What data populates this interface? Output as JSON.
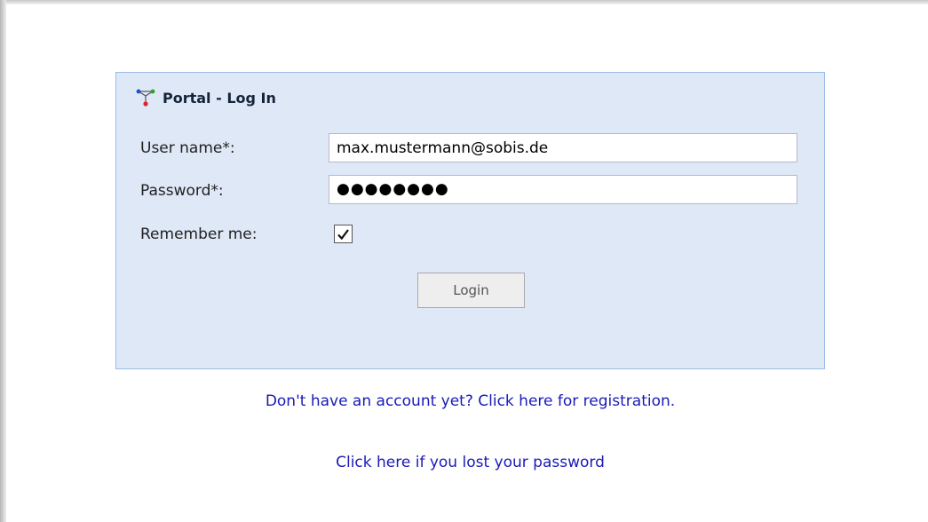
{
  "login": {
    "title": "Portal - Log In",
    "username_label": "User name*:",
    "username_value": "max.mustermann@sobis.de",
    "password_label": "Password*:",
    "password_value": "●●●●●●●●",
    "remember_label": "Remember me:",
    "remember_checked": true,
    "button_label": "Login"
  },
  "links": {
    "register": "Don't have an account yet? Click here for registration.",
    "lost_password": "Click here if you lost your password"
  },
  "icons": {
    "title_icon": "portal-network-icon",
    "checkbox_mark": "checkmark-icon"
  },
  "colors": {
    "panel_bg": "#dfe8f6",
    "panel_border": "#99bbe8",
    "link": "#1a1ab8"
  }
}
